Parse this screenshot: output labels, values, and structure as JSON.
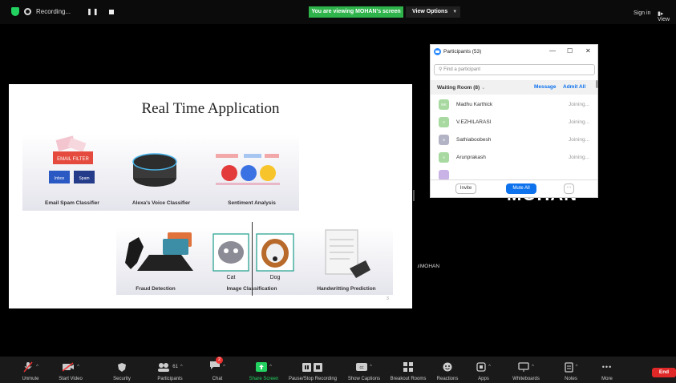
{
  "topbar": {
    "recording_label": "Recording...",
    "pause_label": "❚❚",
    "viewing_banner": "You are viewing MOHAN's screen",
    "view_options": "View Options",
    "sign_in": "Sign in",
    "view_label": "View"
  },
  "slide": {
    "title": "Real Time Application",
    "email_text": "EMAIL FILTER",
    "inbox_label": "Inbox",
    "spam_label": "Spam",
    "cat_label": "Cat",
    "dog_label": "Dog",
    "captions": {
      "email": "Email Spam Classifier",
      "alexa": "Alexa's Voice Classifier",
      "sentiment": "Sentiment Analysis",
      "fraud": "Fraud Detection",
      "image": "Image Classification",
      "handwriting": "Handwritting Prediction"
    },
    "page_number": "3"
  },
  "participants": {
    "title": "Participants (53)",
    "search_placeholder": "Find a participant",
    "waiting_room_label": "Waiting Room (8)",
    "message_label": "Message",
    "admit_all_label": "Admit All",
    "rows": [
      {
        "initials": "MK",
        "name": "Madhu Karthick",
        "status": "Joining...",
        "color": "#a7d9a0"
      },
      {
        "initials": "V",
        "name": "V.EZHILARASI",
        "status": "Joining...",
        "color": "#a7d9a0"
      },
      {
        "initials": "S",
        "name": "Sathiaboobesh",
        "status": "Joining...",
        "color": "#b3b3c6"
      },
      {
        "initials": "A",
        "name": "Arunprakash",
        "status": "Joining...",
        "color": "#a7d9a0"
      }
    ],
    "invite_label": "Invite",
    "mute_all_label": "Mute All",
    "more_label": "···"
  },
  "video": {
    "name_big": "MOHAN",
    "name_tag": "MOHAN"
  },
  "toolbar": {
    "items": [
      {
        "label": "Unmute",
        "icon": "mic-muted-icon"
      },
      {
        "label": "Start Video",
        "icon": "video-off-icon"
      },
      {
        "label": "Security",
        "icon": "shield-icon"
      },
      {
        "label": "Participants",
        "icon": "participants-icon",
        "count": "61"
      },
      {
        "label": "Chat",
        "icon": "chat-icon",
        "badge": "2"
      },
      {
        "label": "Share Screen",
        "icon": "share-screen-icon"
      },
      {
        "label": "Pause/Stop Recording",
        "icon": "recording-controls-icon"
      },
      {
        "label": "Show Captions",
        "icon": "captions-icon"
      },
      {
        "label": "Breakout Rooms",
        "icon": "breakout-rooms-icon"
      },
      {
        "label": "Reactions",
        "icon": "reactions-icon"
      },
      {
        "label": "Apps",
        "icon": "apps-icon"
      },
      {
        "label": "Whiteboards",
        "icon": "whiteboard-icon"
      },
      {
        "label": "Notes",
        "icon": "notes-icon"
      },
      {
        "label": "More",
        "icon": "more-icon"
      }
    ],
    "end_label": "End"
  },
  "colors": {
    "zoom_blue": "#0e72ed",
    "viewing_green": "#2fb44b",
    "share_green": "#23d160",
    "end_red": "#e02828"
  }
}
